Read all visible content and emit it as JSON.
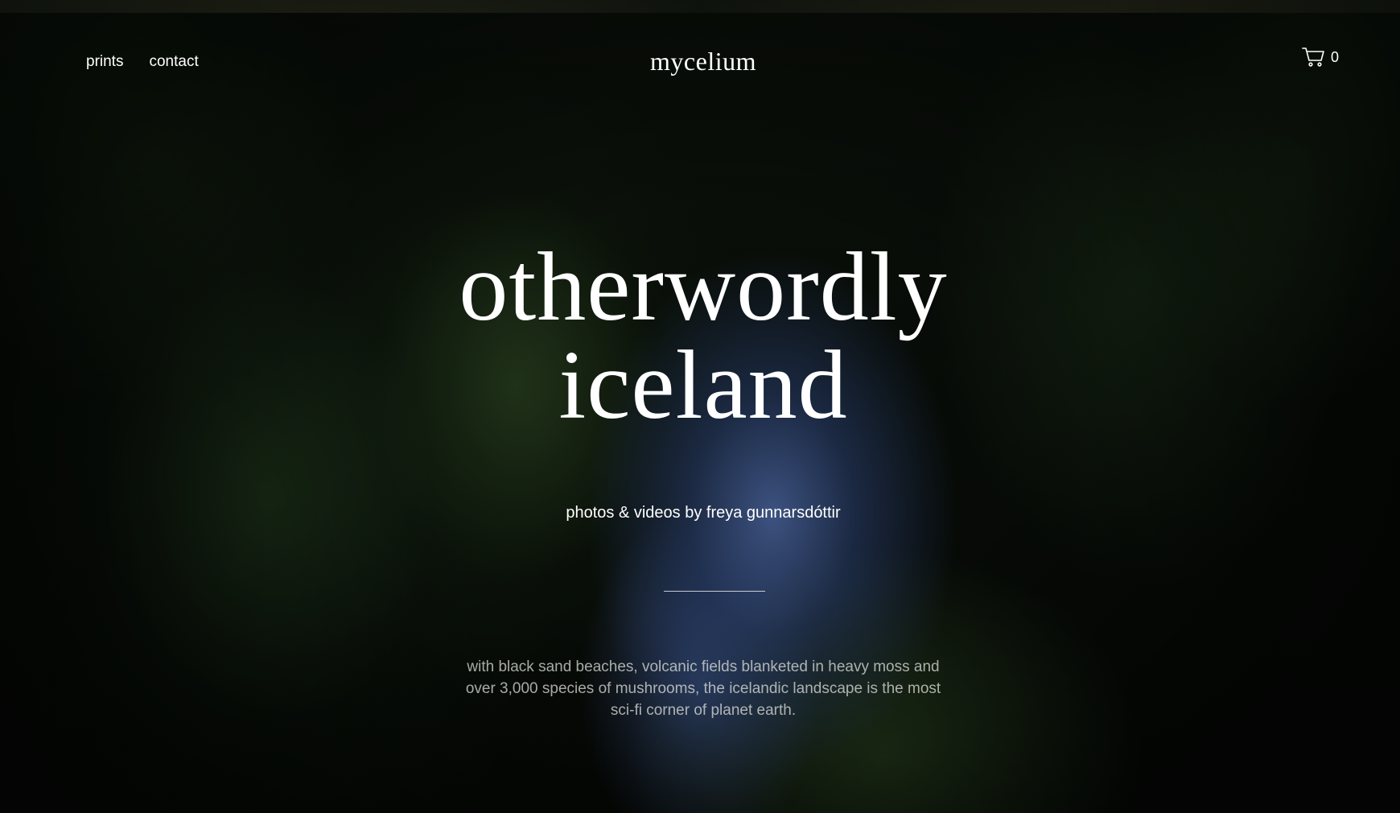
{
  "nav": {
    "items": [
      {
        "label": "prints"
      },
      {
        "label": "contact"
      }
    ]
  },
  "brand": {
    "logo_text": "mycelium"
  },
  "cart": {
    "icon": "cart-icon",
    "count": "0"
  },
  "hero": {
    "title_line1": "otherwordly",
    "title_line2": "iceland",
    "byline": "photos & videos by freya gunnarsdóttir",
    "description": "with black sand beaches, volcanic fields blanketed in heavy moss and over 3,000 species of mushrooms, the icelandic landscape is the most sci-fi corner of planet earth."
  },
  "colors": {
    "text": "#ffffff",
    "background": "#050805",
    "sky_accent": "#3c5a96",
    "moss_accent": "#2e4a25"
  }
}
